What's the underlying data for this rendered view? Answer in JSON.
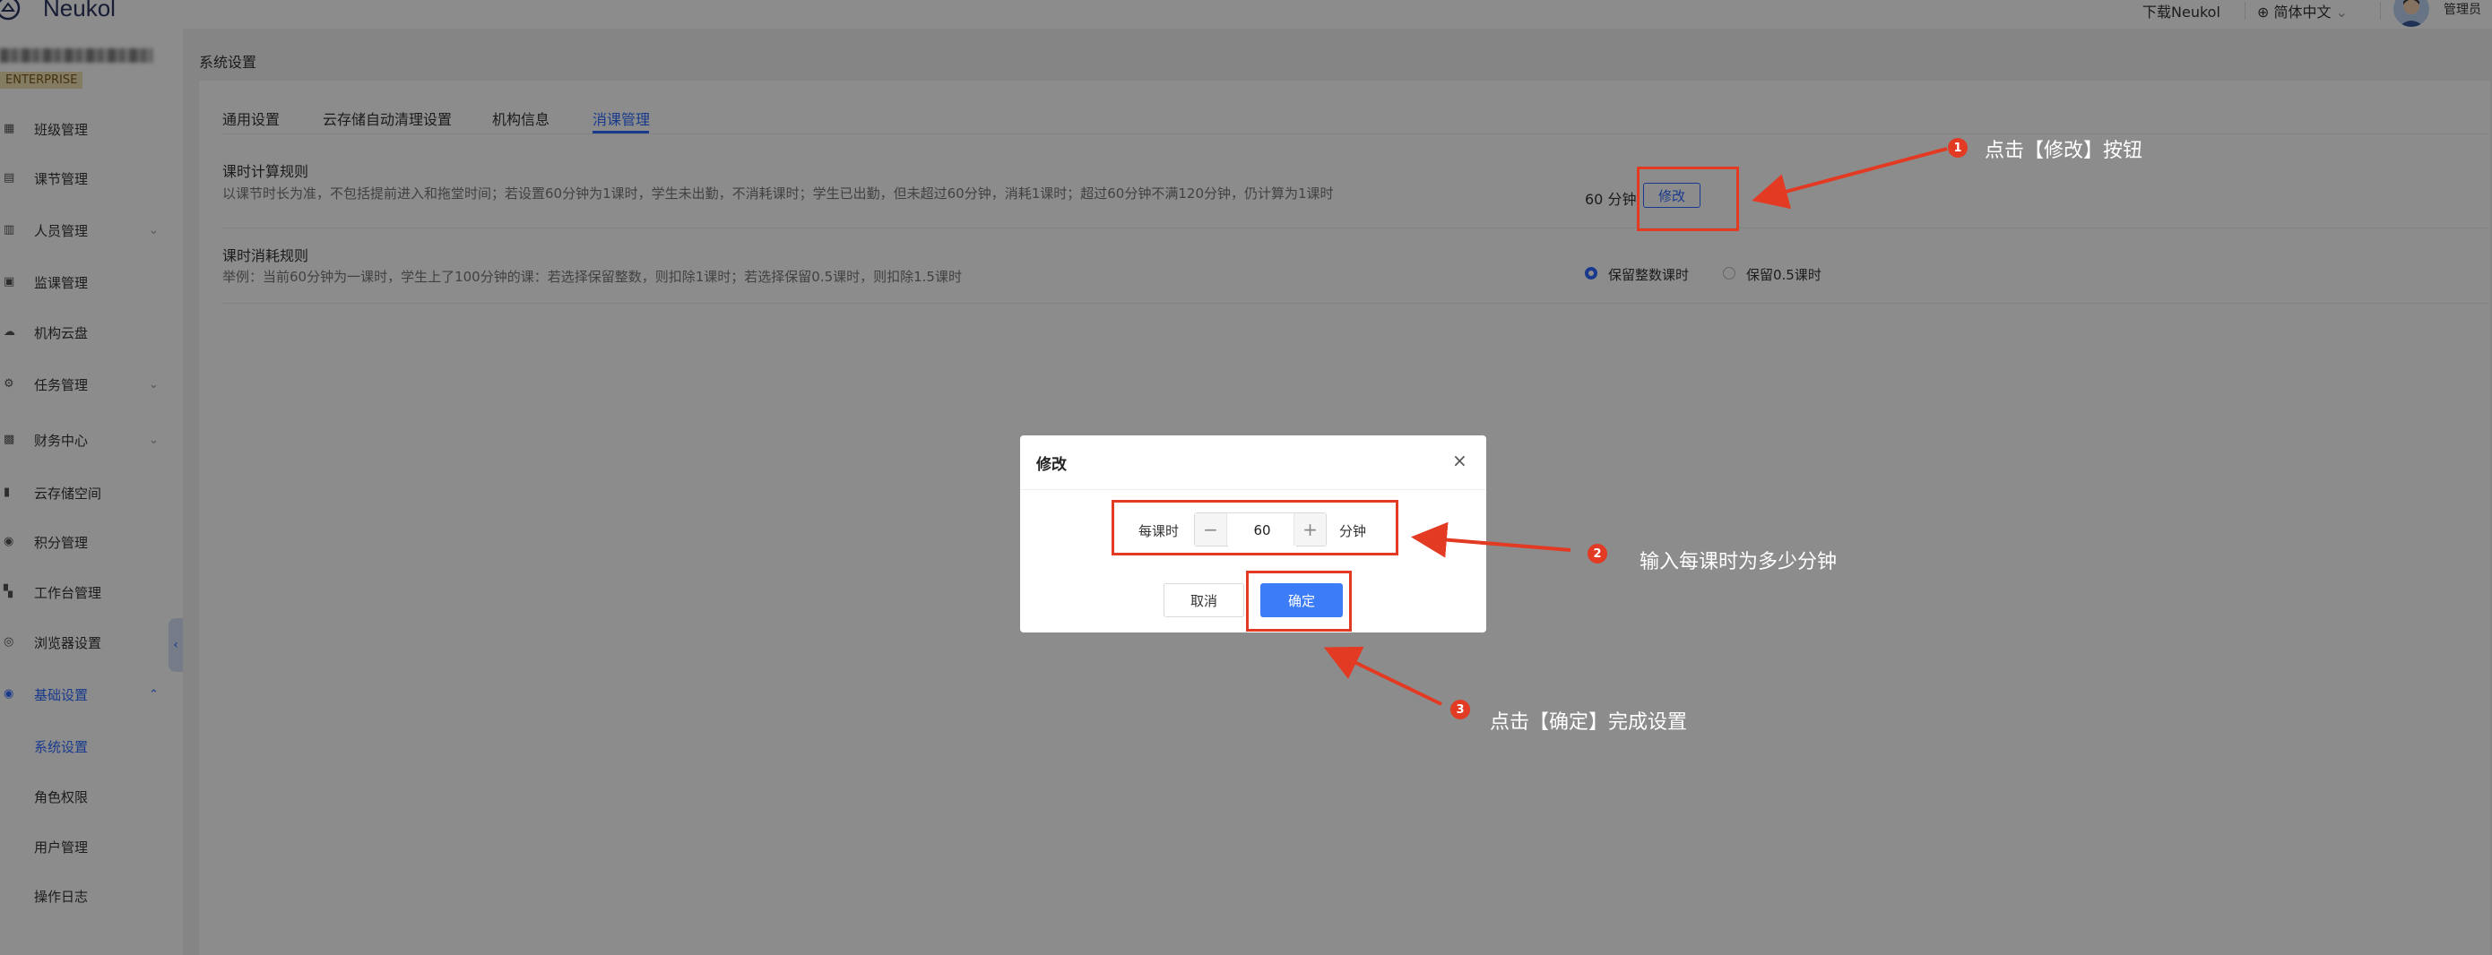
{
  "app": {
    "name": "Neukol",
    "edition": "ENTERPRISE"
  },
  "topbar": {
    "download": "下载Neukol",
    "language": "简体中文",
    "user": "管理员"
  },
  "sidebar": {
    "items": [
      {
        "label": "班级管理",
        "icon": "class-icon"
      },
      {
        "label": "课节管理",
        "icon": "lesson-icon"
      },
      {
        "label": "人员管理",
        "icon": "people-icon"
      },
      {
        "label": "监课管理",
        "icon": "monitor-icon"
      },
      {
        "label": "机构云盘",
        "icon": "cloud-drive-icon"
      },
      {
        "label": "任务管理",
        "icon": "task-icon"
      },
      {
        "label": "财务中心",
        "icon": "finance-icon"
      },
      {
        "label": "云存储空间",
        "icon": "storage-icon"
      },
      {
        "label": "积分管理",
        "icon": "points-icon"
      },
      {
        "label": "工作台管理",
        "icon": "workbench-icon"
      },
      {
        "label": "浏览器设置",
        "icon": "browser-icon"
      },
      {
        "label": "基础设置",
        "icon": "settings-icon"
      }
    ],
    "subitems": [
      "系统设置",
      "角色权限",
      "用户管理",
      "操作日志"
    ]
  },
  "breadcrumb": "系统设置",
  "tabs": [
    "通用设置",
    "云存储自动清理设置",
    "机构信息",
    "消课管理"
  ],
  "rules": {
    "calc": {
      "title": "课时计算规则",
      "desc": "以课节时长为准，不包括提前进入和拖堂时间；若设置60分钟为1课时，学生未出勤，不消耗课时；学生已出勤，但未超过60分钟，消耗1课时；超过60分钟不满120分钟，仍计算为1课时",
      "value": "60 分钟",
      "edit": "修改"
    },
    "consume": {
      "title": "课时消耗规则",
      "desc": "举例：当前60分钟为一课时，学生上了100分钟的课：若选择保留整数，则扣除1课时；若选择保留0.5课时，则扣除1.5课时",
      "option1": "保留整数课时",
      "option2": "保留0.5课时"
    }
  },
  "modal": {
    "title": "修改",
    "close": "×",
    "field_label": "每课时",
    "value": "60",
    "minus": "−",
    "plus": "+",
    "unit": "分钟",
    "cancel": "取消",
    "ok": "确定"
  },
  "annotations": [
    {
      "num": "1",
      "text": "点击【修改】按钮"
    },
    {
      "num": "2",
      "text": "输入每课时为多少分钟"
    },
    {
      "num": "3",
      "text": "点击【确定】完成设置"
    }
  ],
  "colors": {
    "accent": "#2f6bff",
    "annotation": "#e23a23",
    "primary_button": "#3d7cf7"
  }
}
